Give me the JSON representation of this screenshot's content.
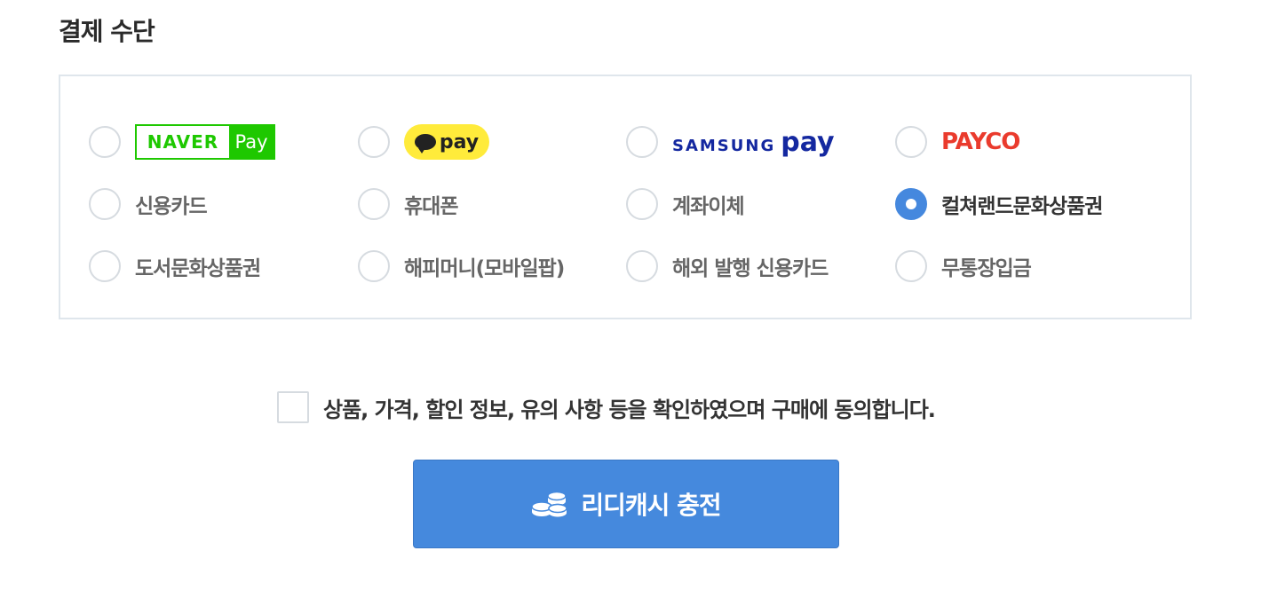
{
  "section_title": "결제 수단",
  "logos": {
    "naver": {
      "left": "NAVER",
      "right": "Pay"
    },
    "kakao": {
      "text": "pay"
    },
    "samsung": {
      "left": "SAMSUNG",
      "right": "pay"
    },
    "payco": {
      "text": "PAYCO"
    }
  },
  "methods": [
    {
      "label": "신용카드",
      "selected": false
    },
    {
      "label": "휴대폰",
      "selected": false
    },
    {
      "label": "계좌이체",
      "selected": false
    },
    {
      "label": "컬쳐랜드문화상품권",
      "selected": true
    },
    {
      "label": "도서문화상품권",
      "selected": false
    },
    {
      "label": "해피머니(모바일팝)",
      "selected": false
    },
    {
      "label": "해외 발행 신용카드",
      "selected": false
    },
    {
      "label": "무통장입금",
      "selected": false
    }
  ],
  "agreement": {
    "text": "상품, 가격, 할인 정보, 유의 사항 등을 확인하였으며 구매에 동의합니다.",
    "checked": false
  },
  "charge_button": {
    "label": "리디캐시 충전"
  },
  "colors": {
    "accent": "#4589dd",
    "naver": "#1ec800",
    "kakao": "#ffeb3b",
    "samsung": "#1428a0",
    "payco": "#ea3b2d"
  }
}
